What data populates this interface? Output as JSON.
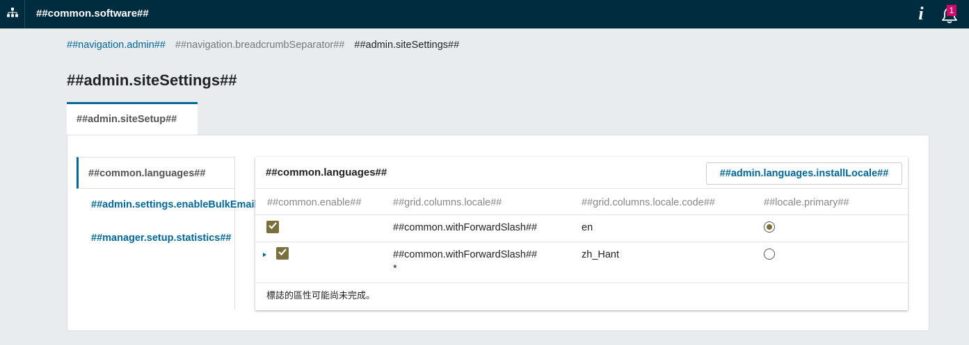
{
  "header": {
    "app_title": "##common.software##",
    "notification_count": "1",
    "icons": [
      "sitemap-icon",
      "info-icon",
      "bell-icon"
    ]
  },
  "breadcrumb": {
    "admin": "##navigation.admin##",
    "separator": "##navigation.breadcrumbSeparator##",
    "current": "##admin.siteSettings##"
  },
  "page": {
    "title": "##admin.siteSettings##",
    "tab_label": "##admin.siteSetup##"
  },
  "sidenav": {
    "items": [
      {
        "label": "##common.languages##"
      },
      {
        "label": "##admin.settings.enableBulkEmails.label##"
      },
      {
        "label": "##manager.setup.statistics##"
      }
    ]
  },
  "grid": {
    "title": "##common.languages##",
    "install_button": "##admin.languages.installLocale##",
    "columns": [
      "##common.enable##",
      "##grid.columns.locale##",
      "##grid.columns.locale.code##",
      "##locale.primary##"
    ],
    "rows": [
      {
        "enabled": true,
        "locale": "##common.withForwardSlash##",
        "locale_suffix": "",
        "code": "en",
        "primary": true
      },
      {
        "enabled": true,
        "locale": "##common.withForwardSlash##",
        "locale_suffix": "*",
        "code": "zh_Hant",
        "primary": false
      }
    ],
    "footnote": "標誌的區性可能尚未完成。"
  },
  "colors": {
    "topbar": "#002c40",
    "accent": "#006798",
    "checkbox": "#7a6f3d",
    "badge": "#d00a6c"
  }
}
